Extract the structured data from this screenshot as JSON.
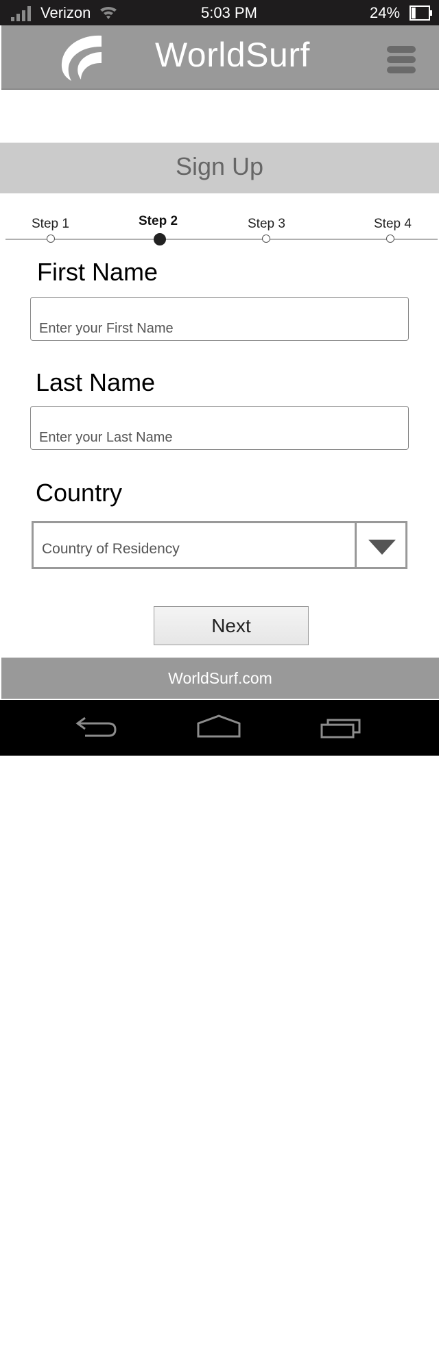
{
  "status_bar": {
    "carrier": "Verizon",
    "time": "5:03 PM",
    "battery": "24%",
    "battery_level": 0.24,
    "icons": [
      "signal-icon",
      "wifi-icon",
      "battery-icon"
    ]
  },
  "app_bar": {
    "title": "WorldSurf",
    "icons": [
      "worldsurf-logo",
      "menu-icon"
    ]
  },
  "page": {
    "title": "Sign Up"
  },
  "steps": {
    "items": [
      {
        "label": "Step 1",
        "active": false
      },
      {
        "label": "Step 2",
        "active": true
      },
      {
        "label": "Step 3",
        "active": false
      },
      {
        "label": "Step 4",
        "active": false
      }
    ]
  },
  "form": {
    "first_name": {
      "label": "First Name",
      "value": "",
      "placeholder": "Enter your First Name"
    },
    "last_name": {
      "label": "Last Name",
      "value": "",
      "placeholder": "Enter your Last Name"
    },
    "country": {
      "label": "Country",
      "selected": "Country of Residency",
      "icon": "dropdown-arrow-icon"
    },
    "next_label": "Next"
  },
  "footer": {
    "text": "WorldSurf.com"
  },
  "nav_bar": {
    "icons": [
      "back-icon",
      "home-icon",
      "recent-apps-icon"
    ]
  },
  "colors": {
    "status_bar": "#1e1c1d",
    "app_bar": "#999999",
    "signup_bar": "#cbcbcb",
    "footer": "#999999",
    "nav_bar": "#000000"
  }
}
